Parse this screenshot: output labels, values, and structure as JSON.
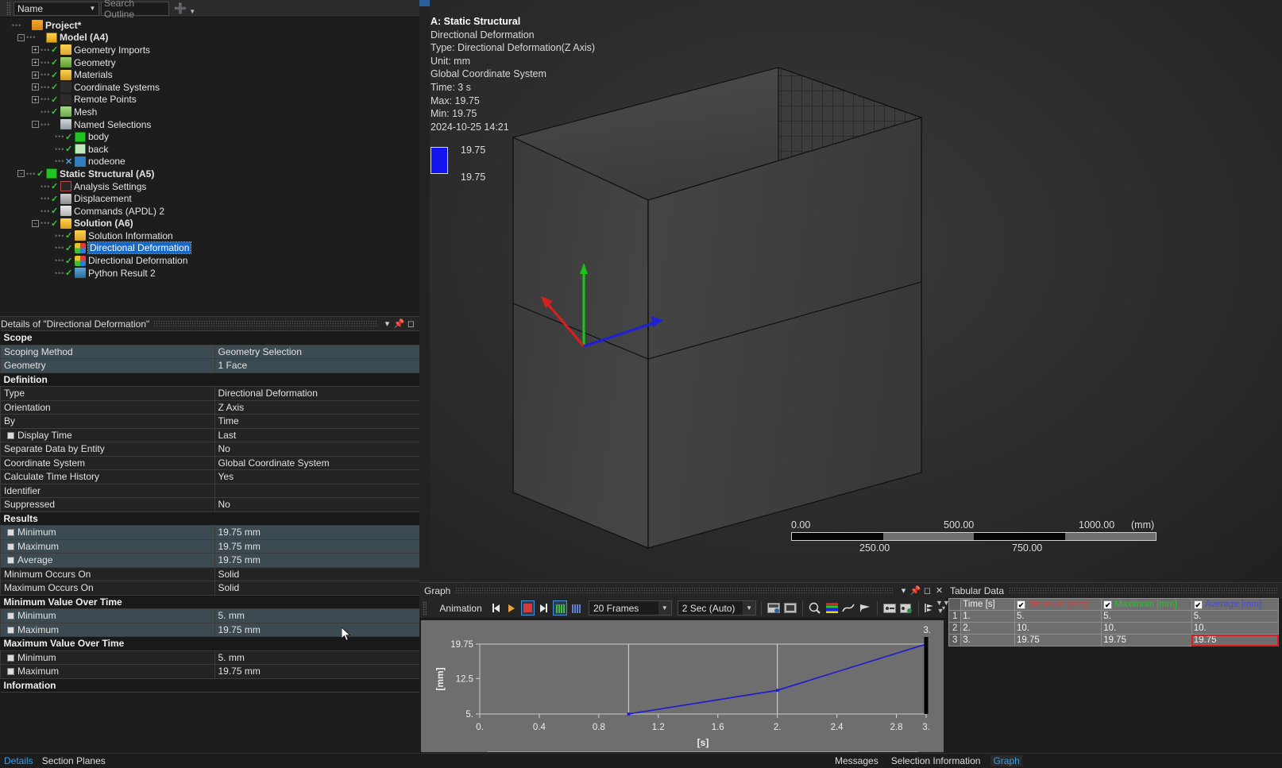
{
  "outline_toolbar": {
    "name_combo": "Name",
    "search_placeholder": "Search Outline",
    "chevron_icon": "chevron-down-orange"
  },
  "tree": {
    "items": [
      {
        "label": "Project*",
        "depth": 0,
        "bold": true,
        "expander": "",
        "check": "",
        "icon": "ic-proj",
        "selected": false
      },
      {
        "label": "Model (A4)",
        "depth": 1,
        "bold": true,
        "expander": "-",
        "check": "",
        "icon": "ic-model",
        "selected": false
      },
      {
        "label": "Geometry Imports",
        "depth": 2,
        "bold": false,
        "expander": "+",
        "check": "v",
        "icon": "ic-geoimp",
        "selected": false
      },
      {
        "label": "Geometry",
        "depth": 2,
        "bold": false,
        "expander": "+",
        "check": "v",
        "icon": "ic-geo",
        "selected": false
      },
      {
        "label": "Materials",
        "depth": 2,
        "bold": false,
        "expander": "+",
        "check": "v",
        "icon": "ic-mat",
        "selected": false
      },
      {
        "label": "Coordinate Systems",
        "depth": 2,
        "bold": false,
        "expander": "+",
        "check": "v",
        "icon": "ic-cs",
        "selected": false
      },
      {
        "label": "Remote Points",
        "depth": 2,
        "bold": false,
        "expander": "+",
        "check": "v",
        "icon": "ic-rp",
        "selected": false
      },
      {
        "label": "Mesh",
        "depth": 2,
        "bold": false,
        "expander": "",
        "check": "v",
        "icon": "ic-mesh",
        "selected": false
      },
      {
        "label": "Named Selections",
        "depth": 2,
        "bold": false,
        "expander": "-",
        "check": "",
        "icon": "ic-ns",
        "selected": false
      },
      {
        "label": "body",
        "depth": 3,
        "bold": false,
        "expander": "",
        "check": "v",
        "icon": "ic-body",
        "selected": false
      },
      {
        "label": "back",
        "depth": 3,
        "bold": false,
        "expander": "",
        "check": "v",
        "icon": "ic-back",
        "selected": false
      },
      {
        "label": "nodeone",
        "depth": 3,
        "bold": false,
        "expander": "",
        "check": "x",
        "icon": "ic-node",
        "selected": false
      },
      {
        "label": "Static Structural (A5)",
        "depth": 1,
        "bold": true,
        "expander": "-",
        "check": "v",
        "icon": "ic-ss",
        "selected": false
      },
      {
        "label": "Analysis Settings",
        "depth": 2,
        "bold": false,
        "expander": "",
        "check": "v",
        "icon": "ic-as",
        "selected": false
      },
      {
        "label": "Displacement",
        "depth": 2,
        "bold": false,
        "expander": "",
        "check": "v",
        "icon": "ic-disp",
        "selected": false
      },
      {
        "label": "Commands (APDL) 2",
        "depth": 2,
        "bold": false,
        "expander": "",
        "check": "v",
        "icon": "ic-cmd",
        "selected": false
      },
      {
        "label": "Solution (A6)",
        "depth": 2,
        "bold": true,
        "expander": "-",
        "check": "v",
        "icon": "ic-sol",
        "selected": false
      },
      {
        "label": "Solution Information",
        "depth": 3,
        "bold": false,
        "expander": "",
        "check": "v",
        "icon": "ic-solinf",
        "selected": false
      },
      {
        "label": "Directional Deformation",
        "depth": 3,
        "bold": false,
        "expander": "",
        "check": "v",
        "icon": "ic-dd",
        "selected": true
      },
      {
        "label": "Directional Deformation",
        "depth": 3,
        "bold": false,
        "expander": "",
        "check": "v",
        "icon": "ic-dd",
        "selected": false
      },
      {
        "label": "Python Result 2",
        "depth": 3,
        "bold": false,
        "expander": "",
        "check": "v",
        "icon": "ic-py",
        "selected": false
      }
    ]
  },
  "details": {
    "title": "Details of \"Directional Deformation\"",
    "window_buttons": [
      "▾",
      "⚑",
      "□",
      "✕"
    ],
    "rows": [
      {
        "kind": "header",
        "key": "Scope"
      },
      {
        "kind": "row",
        "key": "Scoping Method",
        "value": "Geometry Selection",
        "hl": true
      },
      {
        "kind": "row",
        "key": "Geometry",
        "value": "1 Face",
        "hl": true
      },
      {
        "kind": "header",
        "key": "Definition"
      },
      {
        "kind": "row",
        "key": "Type",
        "value": "Directional Deformation",
        "hl": false
      },
      {
        "kind": "row",
        "key": "Orientation",
        "value": "Z Axis",
        "hl": false
      },
      {
        "kind": "row",
        "key": "By",
        "value": "Time",
        "hl": false
      },
      {
        "kind": "row",
        "key": "Display Time",
        "value": "Last",
        "cbox": true,
        "hl": false
      },
      {
        "kind": "row",
        "key": "Separate Data by Entity",
        "value": "No",
        "hl": false
      },
      {
        "kind": "row",
        "key": "Coordinate System",
        "value": "Global Coordinate System",
        "hl": false
      },
      {
        "kind": "row",
        "key": "Calculate Time History",
        "value": "Yes",
        "hl": false
      },
      {
        "kind": "row",
        "key": "Identifier",
        "value": "",
        "hl": false
      },
      {
        "kind": "row",
        "key": "Suppressed",
        "value": "No",
        "hl": false
      },
      {
        "kind": "header",
        "key": "Results"
      },
      {
        "kind": "row",
        "key": "Minimum",
        "value": "19.75 mm",
        "cbox": true,
        "hl": true
      },
      {
        "kind": "row",
        "key": "Maximum",
        "value": "19.75 mm",
        "cbox": true,
        "hl": true
      },
      {
        "kind": "row",
        "key": "Average",
        "value": "19.75 mm",
        "cbox": true,
        "hl": true
      },
      {
        "kind": "row",
        "key": "Minimum Occurs On",
        "value": "Solid",
        "hl": false
      },
      {
        "kind": "row",
        "key": "Maximum Occurs On",
        "value": "Solid",
        "hl": false
      },
      {
        "kind": "header",
        "key": "Minimum Value Over Time"
      },
      {
        "kind": "row",
        "key": "Minimum",
        "value": "5. mm",
        "cbox": true,
        "hl": true
      },
      {
        "kind": "row",
        "key": "Maximum",
        "value": "19.75 mm",
        "cbox": true,
        "hl": true
      },
      {
        "kind": "header",
        "key": "Maximum Value Over Time"
      },
      {
        "kind": "row",
        "key": "Minimum",
        "value": "5. mm",
        "cbox": true,
        "hl": false
      },
      {
        "kind": "row",
        "key": "Maximum",
        "value": "19.75 mm",
        "cbox": true,
        "hl": false
      },
      {
        "kind": "header",
        "key": "Information"
      }
    ]
  },
  "left_status": {
    "details_tab": "Details",
    "section_planes_tab": "Section Planes"
  },
  "viewport": {
    "header_lines": [
      "A: Static Structural",
      "Directional Deformation",
      "Type: Directional Deformation(Z Axis)",
      "Unit: mm",
      "Global Coordinate System",
      "Time: 3 s",
      "Max: 19.75",
      "Min: 19.75",
      "2024-10-25 14:21"
    ],
    "legend": {
      "top_value": "19.75",
      "bottom_value": "19.75",
      "color": "#1414f0"
    },
    "ruler": {
      "top_labels": [
        "0.00",
        "500.00",
        "1000.00"
      ],
      "unit": "(mm)",
      "bottom_labels": [
        "250.00",
        "750.00"
      ]
    },
    "triad": {
      "x_axis_color": "#d81f1f",
      "y_axis_color": "#17c417",
      "z_axis_color": "#1f1fd8"
    }
  },
  "graph": {
    "title": "Graph",
    "window_buttons": [
      "▾",
      "⚑",
      "□",
      "✕"
    ],
    "animation": {
      "label": "Animation",
      "frames_value": "20 Frames",
      "duration_value": "2 Sec (Auto)",
      "buttons": [
        "skip-back-icon",
        "play-icon",
        "stop-icon",
        "skip-forward-icon",
        "distributed-bars-icon",
        "single-bars-icon"
      ]
    },
    "step_bar": [
      "1",
      "2",
      "3"
    ]
  },
  "chart_data": {
    "type": "line",
    "title": "",
    "xlabel": "[s]",
    "ylabel": "[mm]",
    "xlim": [
      0,
      3
    ],
    "ylim": [
      5,
      19.75
    ],
    "xticks": [
      "0.",
      "0.4",
      "0.8",
      "1.2",
      "1.6",
      "2.",
      "2.4",
      "2.8",
      "3."
    ],
    "xtick_values": [
      0,
      0.4,
      0.8,
      1.2,
      1.6,
      2.0,
      2.4,
      2.8,
      3.0
    ],
    "yticks": [
      "5.",
      "12.5",
      "19.75"
    ],
    "ytick_values": [
      5,
      12.5,
      19.75
    ],
    "grid": true,
    "legend": null,
    "series": [
      {
        "name": "Directional Deformation",
        "color": "#1a1ad0",
        "x": [
          1,
          2,
          3
        ],
        "y": [
          5,
          10,
          19.75
        ]
      }
    ],
    "time_marker": {
      "x": 3,
      "label": "3.",
      "color": "#000000"
    }
  },
  "tabular": {
    "title": "Tabular Data",
    "window_buttons": [
      "□",
      "✕"
    ],
    "columns": [
      {
        "label": "Time [s]",
        "checkbox": false,
        "color": "#f0f0f0"
      },
      {
        "label": "Minimum [mm]",
        "checkbox": true,
        "color": "#e03b3b"
      },
      {
        "label": "Maximum [mm]",
        "checkbox": true,
        "color": "#2fbf2f"
      },
      {
        "label": "Average [mm]",
        "checkbox": true,
        "color": "#4a4ae0"
      }
    ],
    "rows": [
      {
        "n": "1",
        "cells": [
          "1.",
          "5.",
          "5.",
          "5."
        ],
        "highlight": null
      },
      {
        "n": "2",
        "cells": [
          "2.",
          "10.",
          "10.",
          "10."
        ],
        "highlight": null
      },
      {
        "n": "3",
        "cells": [
          "3.",
          "19.75",
          "19.75",
          "19.75"
        ],
        "highlight": 3
      }
    ]
  },
  "bottom_status": {
    "tabs": [
      {
        "label": "Messages",
        "active": false
      },
      {
        "label": "Selection Information",
        "active": false
      },
      {
        "label": "Graph",
        "active": true
      }
    ]
  }
}
